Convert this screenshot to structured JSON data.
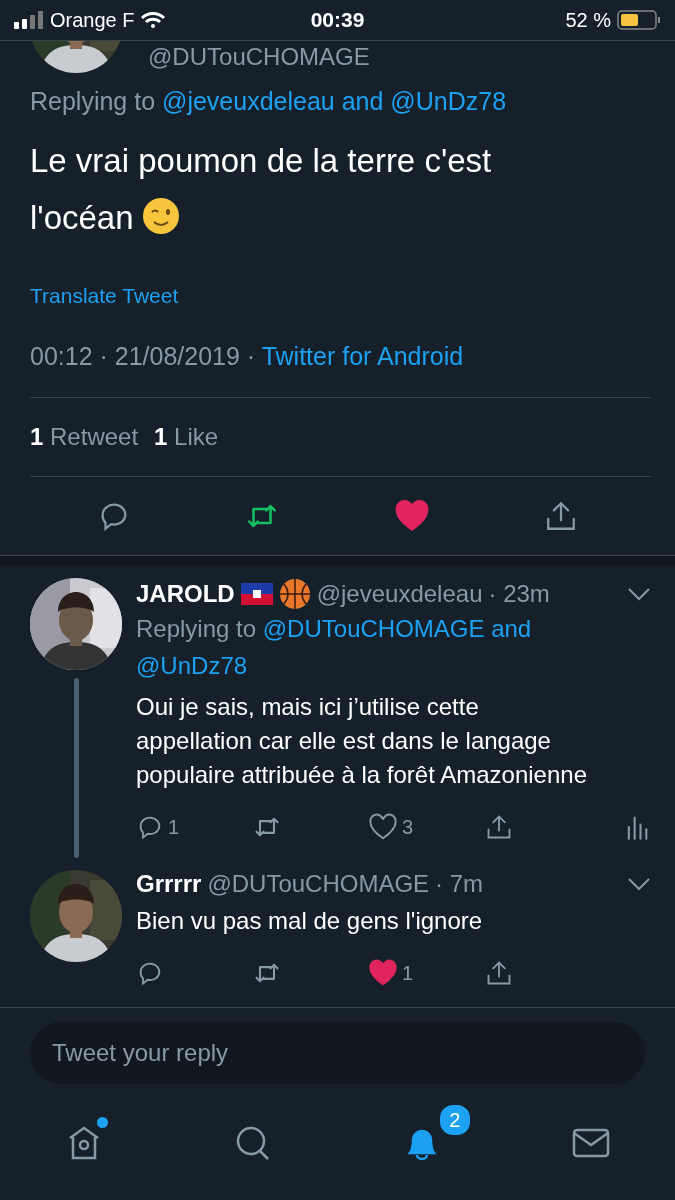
{
  "status_bar": {
    "carrier": "Orange F",
    "time": "00:39",
    "battery": "52 %"
  },
  "tweet": {
    "handle": "@DUTouCHOMAGE",
    "replying": {
      "prefix": "Replying to",
      "conjunction": "and",
      "mentions": [
        "@jeveuxdeleau",
        "@UnDz78"
      ]
    },
    "text": "Le vrai poumon de la terre c'est l'océan",
    "translate": "Translate Tweet",
    "meta": "00:12 · 21/08/2019 · ",
    "source": "Twitter for Android",
    "stats": [
      "**1** Retweet",
      "**1** Like"
    ],
    "retweeted": true,
    "liked": true
  },
  "replies": [
    {
      "name": "JAROLD",
      "handle": "@jeveuxdeleau",
      "time": "· 23m",
      "thread_line": true,
      "replying": {
        "prefix": "Replying to",
        "conjunction": "and",
        "mentions": [
          "@DUTouCHOMAGE",
          "@UnDz78"
        ]
      },
      "text": "Oui je sais, mais ici j’utilise cette appellation car elle est dans le langage populaire attribuée à la forêt Amazonienne",
      "reply_count": "1",
      "like_count": "3",
      "liked": false,
      "analytics": true
    },
    {
      "name": "Grrrrr",
      "handle": "@DUTouCHOMAGE",
      "time": "· 7m",
      "thread_line": false,
      "text": "Bien vu pas mal de gens l'ignore",
      "like_count": "1",
      "liked": true,
      "analytics": false
    }
  ],
  "reply_field": {
    "placeholder": "Tweet your reply"
  },
  "tab_bar": {
    "home_dot": true,
    "notifications_badge": "2",
    "tabs": [
      {
        "kind": "home",
        "selected": false
      },
      {
        "kind": "search",
        "selected": false
      },
      {
        "kind": "notifications",
        "selected": true
      },
      {
        "kind": "messages",
        "selected": false
      }
    ]
  }
}
